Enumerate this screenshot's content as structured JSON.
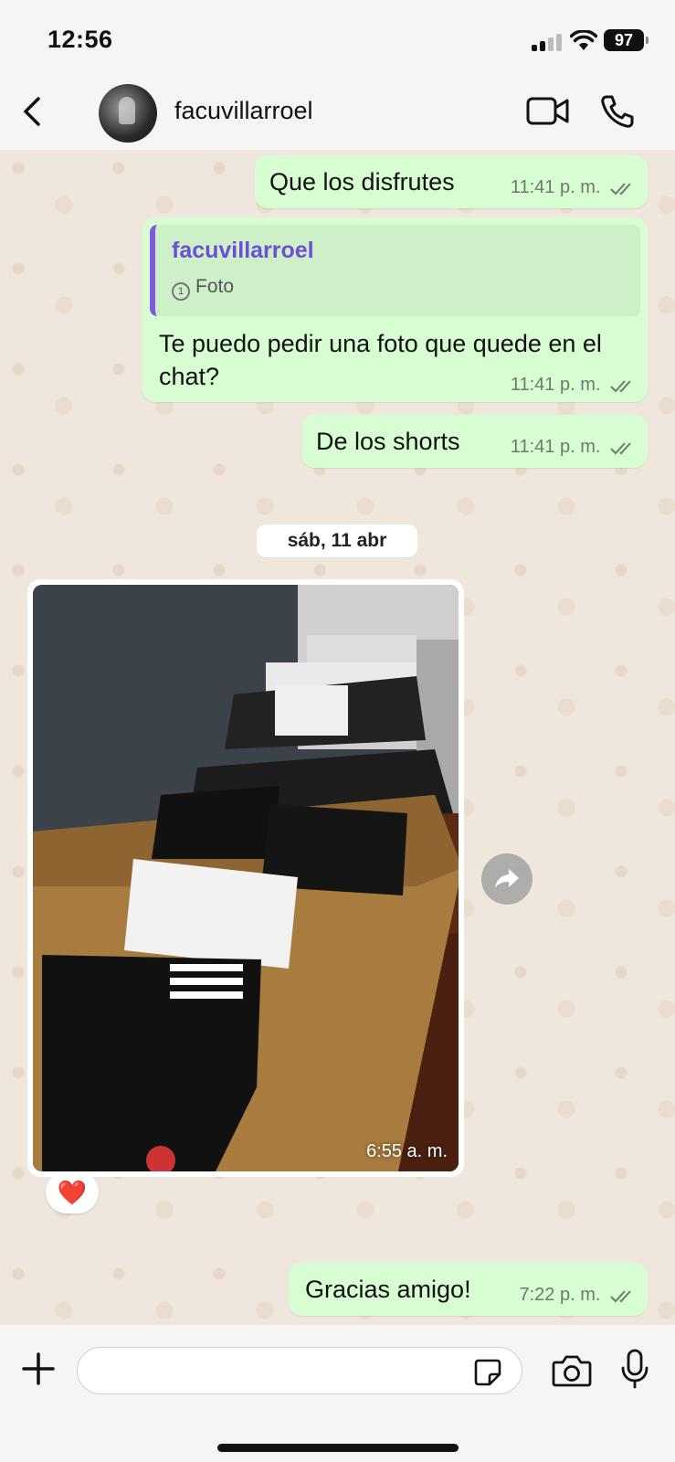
{
  "status": {
    "time": "12:56",
    "battery": "97"
  },
  "header": {
    "contact_name": "facuvillarroel"
  },
  "messages": [
    {
      "text": "Que los disfrutes",
      "time": "11:41 p. m."
    },
    {
      "quote_name": "facuvillarroel",
      "quote_type": "Foto",
      "text": "Te puedo pedir una foto que quede en el chat?",
      "time": "11:41 p. m."
    },
    {
      "text": "De los shorts",
      "time": "11:41 p. m."
    }
  ],
  "date_separator": "sáb, 11 abr",
  "photo_message": {
    "time": "6:55 a. m.",
    "reaction": "❤️"
  },
  "last_message": {
    "text": "Gracias amigo!",
    "time": "7:22 p. m."
  },
  "composer": {
    "value": "",
    "placeholder": ""
  }
}
